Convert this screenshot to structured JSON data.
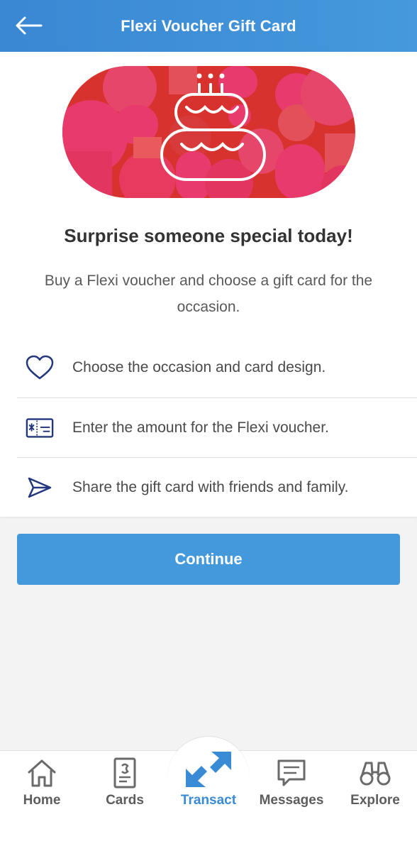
{
  "header": {
    "title": "Flexi Voucher Gift Card",
    "back_icon": "arrow-left-icon"
  },
  "hero": {
    "banner_icon": "birthday-cake-icon",
    "headline": "Surprise someone special today!",
    "subtext": "Buy a Flexi voucher and choose a gift card for the occasion."
  },
  "features": [
    {
      "icon": "heart-icon",
      "text": "Choose the occasion and card design."
    },
    {
      "icon": "voucher-card-icon",
      "text": "Enter the amount for the Flexi voucher."
    },
    {
      "icon": "send-icon",
      "text": "Share the gift card with friends and family."
    }
  ],
  "actions": {
    "continue_label": "Continue"
  },
  "bottom_nav": {
    "items": [
      {
        "label": "Home",
        "icon": "home-icon"
      },
      {
        "label": "Cards",
        "icon": "cards-icon"
      },
      {
        "label": "Transact",
        "icon": "transact-icon",
        "active": true
      },
      {
        "label": "Messages",
        "icon": "messages-icon"
      },
      {
        "label": "Explore",
        "icon": "binoculars-icon"
      }
    ]
  },
  "colors": {
    "header_bg": "#3f90d8",
    "accent": "#4499dc",
    "icon_navy": "#22377e",
    "banner_red": "#d8322e",
    "banner_pink": "#e83a6c",
    "active_nav": "#3a8bd6"
  }
}
